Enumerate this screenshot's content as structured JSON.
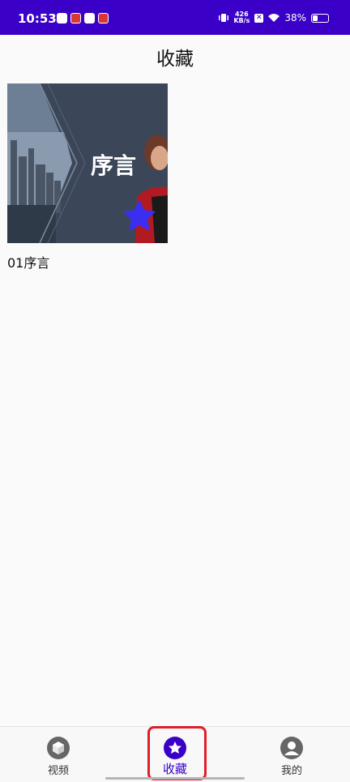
{
  "status_bar": {
    "time": "10:53",
    "net_speed_top": "426",
    "net_speed_unit": "KB/s",
    "battery_percent": "38%",
    "battery_level": 0.38
  },
  "page": {
    "title": "收藏"
  },
  "videos": [
    {
      "label": "01序言",
      "thumbnail_text": "序言"
    }
  ],
  "bottom_nav": {
    "items": [
      {
        "label": "视频",
        "icon": "cube-icon"
      },
      {
        "label": "收藏",
        "icon": "star-icon"
      },
      {
        "label": "我的",
        "icon": "person-icon"
      }
    ],
    "active_index": 1
  },
  "colors": {
    "accent": "#3a00c8",
    "highlight": "#e01e2a"
  }
}
